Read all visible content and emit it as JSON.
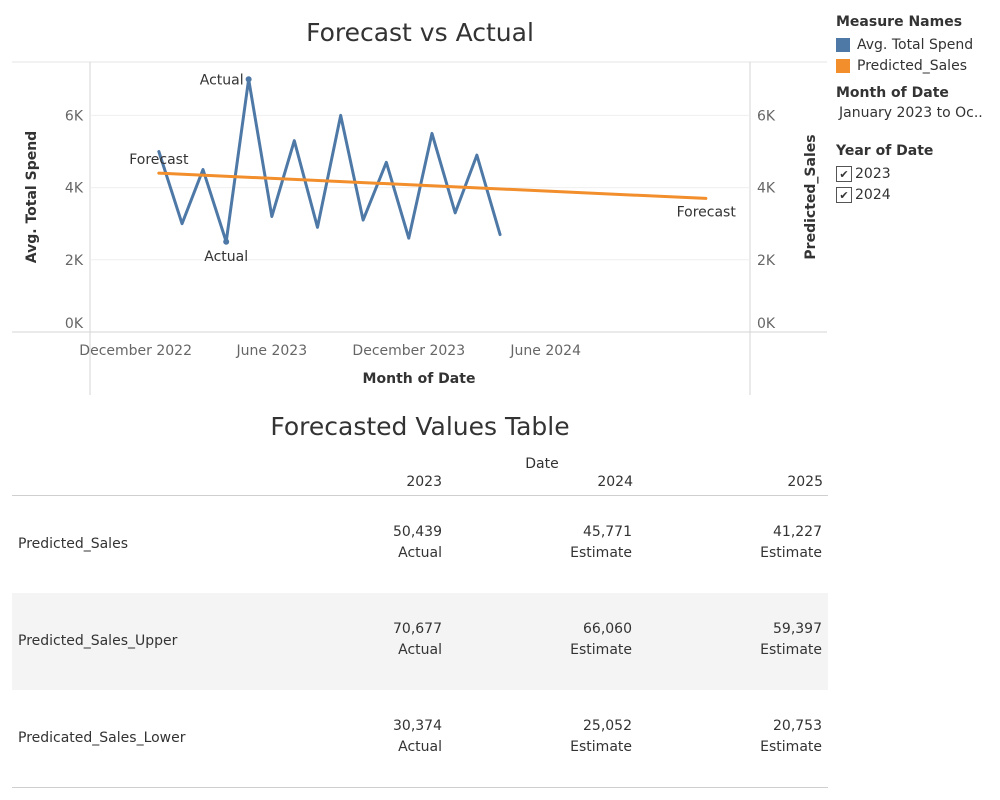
{
  "chart_data": {
    "type": "line",
    "title": "Forecast vs Actual",
    "xlabel": "Month of Date",
    "ylabel_left": "Avg. Total Spend",
    "ylabel_right": "Predicted_Sales",
    "x_ticks": [
      "December 2022",
      "June 2023",
      "December 2023",
      "June 2024"
    ],
    "y_ticks_left": [
      "0K",
      "2K",
      "4K",
      "6K"
    ],
    "y_ticks_right": [
      "0K",
      "2K",
      "4K",
      "6K"
    ],
    "ylim": [
      0,
      7500
    ],
    "xlim": [
      "2022-10-01",
      "2025-03-01"
    ],
    "grid": true,
    "series": [
      {
        "name": "Avg. Total Spend",
        "color": "#4e79a7",
        "x": [
          "2023-01-01",
          "2023-02-01",
          "2023-03-01",
          "2023-04-01",
          "2023-05-01",
          "2023-06-01",
          "2023-07-01",
          "2023-08-01",
          "2023-09-01",
          "2023-10-01",
          "2023-11-01",
          "2023-12-01",
          "2024-01-01",
          "2024-02-01",
          "2024-03-01",
          "2024-04-01"
        ],
        "values": [
          5000,
          3000,
          4500,
          2500,
          7000,
          3200,
          5300,
          2900,
          6000,
          3100,
          4700,
          2600,
          5500,
          3300,
          4900,
          2700
        ]
      },
      {
        "name": "Predicted_Sales",
        "color": "#f28e2b",
        "x": [
          "2023-01-01",
          "2025-01-01"
        ],
        "values": [
          4400,
          3700
        ]
      }
    ],
    "annotations": [
      {
        "text": "Actual",
        "x": "2023-05-01",
        "y": 7000
      },
      {
        "text": "Actual",
        "x": "2023-04-01",
        "y": 2500
      },
      {
        "text": "Forecast",
        "x": "2023-01-01",
        "y": 4400
      },
      {
        "text": "Forecast",
        "x": "2025-01-01",
        "y": 3700
      }
    ]
  },
  "legend": {
    "measure_names_title": "Measure Names",
    "items": [
      {
        "label": "Avg. Total Spend",
        "color": "#4e79a7"
      },
      {
        "label": "Predicted_Sales",
        "color": "#f28e2b"
      }
    ],
    "month_filter_title": "Month of Date",
    "month_filter_value": "January 2023 to Oc..",
    "year_filter_title": "Year of Date",
    "years": [
      {
        "label": "2023",
        "checked": true
      },
      {
        "label": "2024",
        "checked": true
      }
    ],
    "check_mark": "✔"
  },
  "table": {
    "title": "Forecasted Values Table",
    "date_header": "Date",
    "columns": [
      "2023",
      "2024",
      "2025"
    ],
    "rows": [
      {
        "label": "Predicted_Sales",
        "cells": [
          {
            "value": "50,439",
            "kind": "Actual"
          },
          {
            "value": "45,771",
            "kind": "Estimate"
          },
          {
            "value": "41,227",
            "kind": "Estimate"
          }
        ]
      },
      {
        "label": "Predicted_Sales_Upper",
        "cells": [
          {
            "value": "70,677",
            "kind": "Actual"
          },
          {
            "value": "66,060",
            "kind": "Estimate"
          },
          {
            "value": "59,397",
            "kind": "Estimate"
          }
        ]
      },
      {
        "label": "Predicated_Sales_Lower",
        "cells": [
          {
            "value": "30,374",
            "kind": "Actual"
          },
          {
            "value": "25,052",
            "kind": "Estimate"
          },
          {
            "value": "20,753",
            "kind": "Estimate"
          }
        ]
      }
    ]
  }
}
